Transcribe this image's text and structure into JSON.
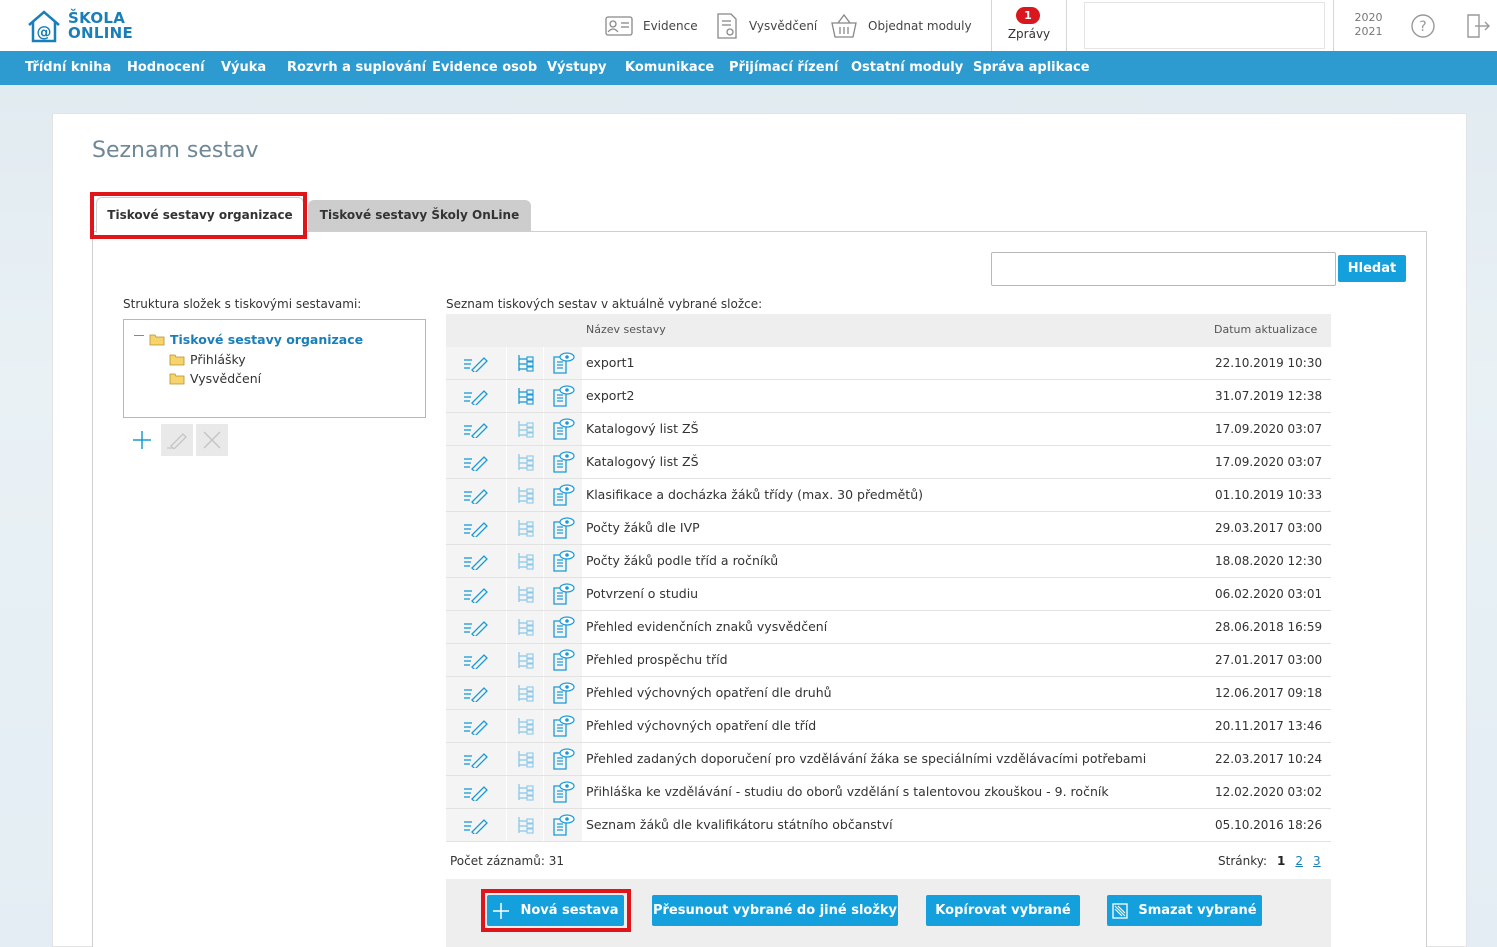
{
  "app": {
    "logo_line1": "ŠKOLA",
    "logo_line2": "ONLINE"
  },
  "topbar": {
    "evidence": "Evidence",
    "vysvedceni": "Vysvědčení",
    "objednat": "Objednat moduly",
    "zpravy_label": "Zprávy",
    "zpravy_count": "1",
    "year_line1": "2020",
    "year_line2": "2021"
  },
  "nav": [
    "Třídní kniha",
    "Hodnocení",
    "Výuka",
    "Rozvrh a suplování",
    "Evidence osob",
    "Výstupy",
    "Komunikace",
    "Přijímací řízení",
    "Ostatní moduly",
    "Správa aplikace"
  ],
  "page": {
    "title": "Seznam sestav",
    "tab_active": "Tiskové sestavy organizace",
    "tab_inactive": "Tiskové sestavy Školy OnLine",
    "search_value": "",
    "search_button": "Hledat"
  },
  "tree": {
    "label": "Struktura složek s tiskovými sestavami:",
    "root": "Tiskové sestavy organizace",
    "children": [
      "Přihlášky",
      "Vysvědčení"
    ]
  },
  "table": {
    "label": "Seznam tiskových sestav v aktuálně vybrané složce:",
    "col_name": "Název sestavy",
    "col_date": "Datum aktualizace",
    "rows": [
      {
        "name": "export1",
        "date": "22.10.2019 10:30"
      },
      {
        "name": "export2",
        "date": "31.07.2019 12:38"
      },
      {
        "name": "Katalogový list ZŠ",
        "date": "17.09.2020 03:07"
      },
      {
        "name": "Katalogový list ZŠ",
        "date": "17.09.2020 03:07"
      },
      {
        "name": "Klasifikace a docházka žáků třídy (max. 30 předmětů)",
        "date": "01.10.2019 10:33"
      },
      {
        "name": "Počty žáků dle IVP",
        "date": "29.03.2017 03:00"
      },
      {
        "name": "Počty žáků podle tříd a ročníků",
        "date": "18.08.2020 12:30"
      },
      {
        "name": "Potvrzení o studiu",
        "date": "06.02.2020 03:01"
      },
      {
        "name": "Přehled evidenčních znaků vysvědčení",
        "date": "28.06.2018 16:59"
      },
      {
        "name": "Přehled prospěchu tříd",
        "date": "27.01.2017 03:00"
      },
      {
        "name": "Přehled výchovných opatření dle druhů",
        "date": "12.06.2017 09:18"
      },
      {
        "name": "Přehled výchovných opatření dle tříd",
        "date": "20.11.2017 13:46"
      },
      {
        "name": "Přehled zadaných doporučení pro vzdělávání žáka se speciálními vzdělávacími potřebami",
        "date": "22.03.2017 10:24"
      },
      {
        "name": "Přihláška ke vzdělávání - studiu do oborů vzdělání s talentovou zkouškou - 9. ročník",
        "date": "12.02.2020 03:02"
      },
      {
        "name": "Seznam žáků dle kvalifikátoru státního občanství",
        "date": "05.10.2016 18:26"
      }
    ],
    "count_label": "Počet záznamů: 31",
    "pages_label": "Stránky:",
    "pages": [
      "1",
      "2",
      "3"
    ]
  },
  "buttons": {
    "new": "Nová sestava",
    "move": "Přesunout vybrané do jiné složky",
    "copy": "Kopírovat vybrané",
    "delete": "Smazat vybrané"
  },
  "colors": {
    "nav_bg": "#2e9bd0",
    "accent": "#14a0dc",
    "highlight_frame": "#e0141b",
    "badge": "#d8181e"
  }
}
